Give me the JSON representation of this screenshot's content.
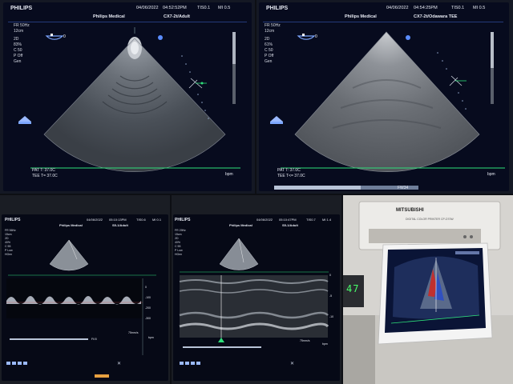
{
  "panel_a": {
    "brand": "PHILIPS",
    "date": "04/06/2022",
    "time": "04:52:52PM",
    "ti": "TIS0.1",
    "mi": "MI 0.5",
    "facility": "Philips Medical",
    "probe": "CX7-2t/Adult",
    "params": [
      "FR 50Hz",
      "12cm",
      "2D",
      "83%",
      "C 50",
      "P Off",
      "Gen"
    ],
    "temps": [
      "PAT T: 37.0C",
      "TEE T= 37.0C"
    ],
    "unit": "bpm"
  },
  "panel_b": {
    "brand": "PHILIPS",
    "date": "04/06/2022",
    "time": "04:54:25PM",
    "ti": "TIS0.1",
    "mi": "MI 0.5",
    "facility": "Philips Medical",
    "probe": "CX7-2t/Odawara TEE",
    "params": [
      "FR 50Hz",
      "12cm",
      "2D",
      "61%",
      "C 50",
      "P Off",
      "Gen"
    ],
    "temps": [
      "PAT T: 37.0C",
      "TEE T<= 37.0C"
    ],
    "unit": "bpm",
    "status": "FW34"
  },
  "panel_c": {
    "brand": "PHILIPS",
    "date": "04/06/2022",
    "time": "05:10:13PM",
    "ti": "TIS0.6",
    "mi": "MI 0.1",
    "facility": "Philips Medical",
    "probe": "S5-1/Adult",
    "params": [
      "FR 56Hz",
      "15cm",
      "2D",
      "40%",
      "C 55",
      "P Low",
      "HGen"
    ],
    "scale": [
      "0",
      "-100",
      "-200",
      "-300"
    ],
    "speed": "75mm/s",
    "unit": "bpm",
    "marker": "Fil 8"
  },
  "panel_d": {
    "brand": "PHILIPS",
    "date": "04/06/2022",
    "time": "05:10:47PM",
    "ti": "TIS0.7",
    "mi": "MI 1.4",
    "facility": "Philips Medical",
    "probe": "S5-1/Adult",
    "params": [
      "FR 29Hz",
      "15cm",
      "2D",
      "40%",
      "C 55",
      "P Low",
      "HGen"
    ],
    "scale": [
      "0",
      "-5",
      "-10"
    ],
    "speed": "75mm/s",
    "unit": "bpm"
  },
  "panel_e": {
    "brand": "MITSUBISHI",
    "model": "DIGITAL COLOR PRINTER CP-D70W",
    "display": "47"
  }
}
